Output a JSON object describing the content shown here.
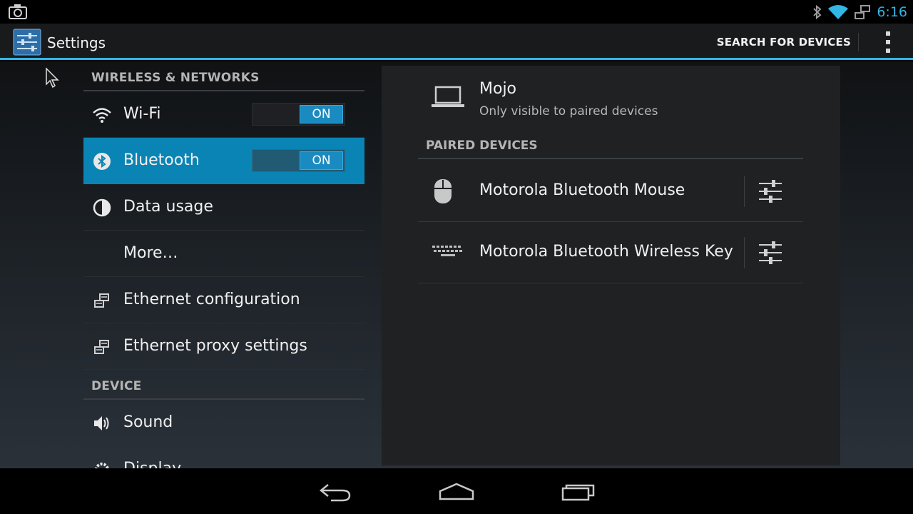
{
  "status_bar": {
    "time": "6:16",
    "icons": [
      "camera-icon",
      "bluetooth-icon",
      "wifi-icon",
      "ethernet-icon"
    ]
  },
  "action_bar": {
    "title": "Settings",
    "search_button": "SEARCH FOR DEVICES",
    "accent_color": "#33b5e5"
  },
  "left_pane": {
    "wireless_header": "WIRELESS & NETWORKS",
    "items": [
      {
        "label": "Wi-Fi",
        "icon": "wifi-icon",
        "toggle": "ON"
      },
      {
        "label": "Bluetooth",
        "icon": "bluetooth-icon",
        "toggle": "ON",
        "selected": true
      },
      {
        "label": "Data usage",
        "icon": "data-usage-icon"
      },
      {
        "label": "More…"
      },
      {
        "label": "Ethernet configuration",
        "icon": "ethernet-icon"
      },
      {
        "label": "Ethernet proxy settings",
        "icon": "ethernet-icon"
      }
    ],
    "device_header": "DEVICE",
    "device_items": [
      {
        "label": "Sound",
        "icon": "speaker-icon"
      },
      {
        "label": "Display",
        "icon": "gear-icon"
      }
    ],
    "selected_color": "#0a84b4"
  },
  "right_pane": {
    "this_device": {
      "name": "Mojo",
      "subtitle": "Only visible to paired devices",
      "icon": "laptop-icon"
    },
    "paired_header": "PAIRED DEVICES",
    "paired_devices": [
      {
        "name": "Motorola Bluetooth Mouse",
        "icon": "mouse-icon"
      },
      {
        "name": "Motorola Bluetooth Wireless Keyboard",
        "icon": "keyboard-icon"
      }
    ]
  },
  "nav_bar": {
    "buttons": [
      "back-icon",
      "home-icon",
      "recents-icon"
    ]
  }
}
